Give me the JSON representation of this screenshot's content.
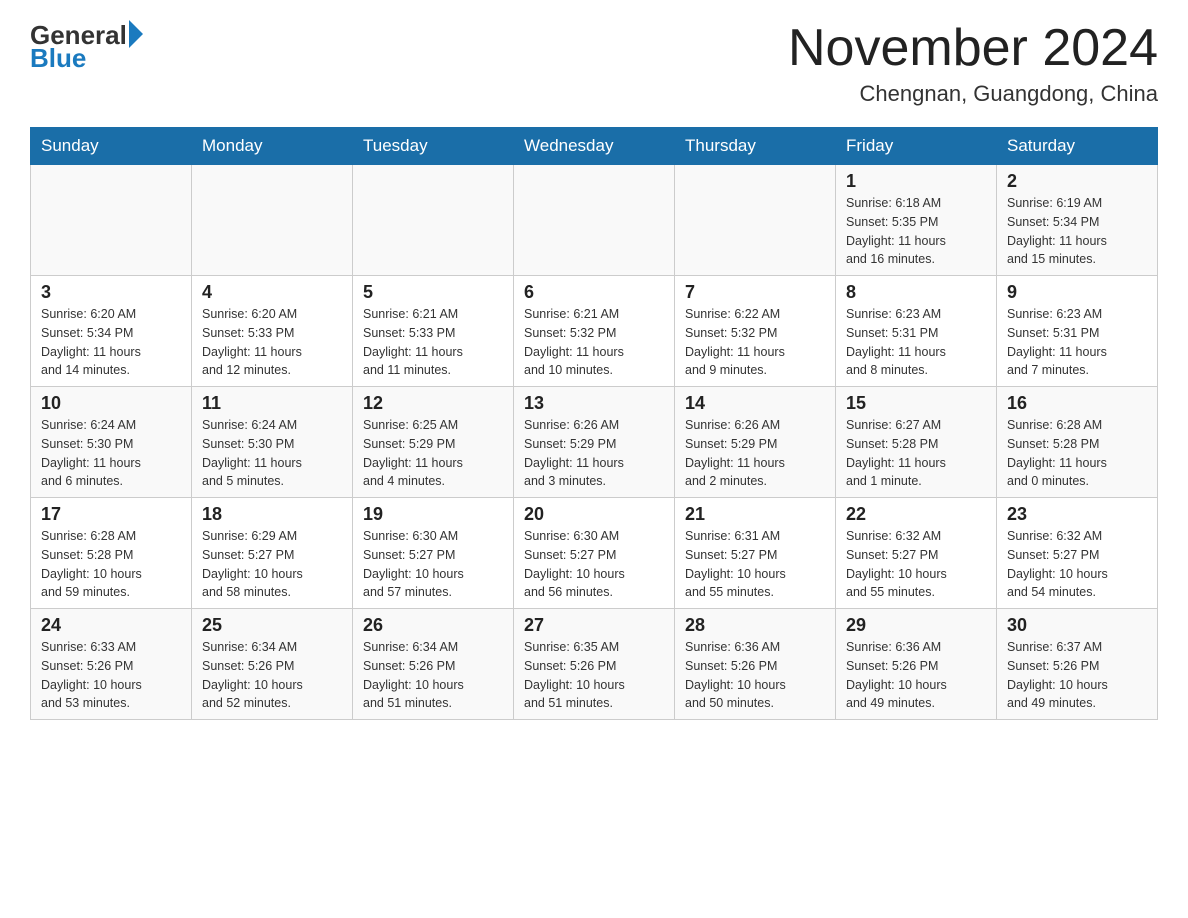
{
  "header": {
    "logo_general": "General",
    "logo_blue": "Blue",
    "month_title": "November 2024",
    "location": "Chengnan, Guangdong, China"
  },
  "weekdays": [
    "Sunday",
    "Monday",
    "Tuesday",
    "Wednesday",
    "Thursday",
    "Friday",
    "Saturday"
  ],
  "weeks": [
    [
      {
        "day": "",
        "info": ""
      },
      {
        "day": "",
        "info": ""
      },
      {
        "day": "",
        "info": ""
      },
      {
        "day": "",
        "info": ""
      },
      {
        "day": "",
        "info": ""
      },
      {
        "day": "1",
        "info": "Sunrise: 6:18 AM\nSunset: 5:35 PM\nDaylight: 11 hours\nand 16 minutes."
      },
      {
        "day": "2",
        "info": "Sunrise: 6:19 AM\nSunset: 5:34 PM\nDaylight: 11 hours\nand 15 minutes."
      }
    ],
    [
      {
        "day": "3",
        "info": "Sunrise: 6:20 AM\nSunset: 5:34 PM\nDaylight: 11 hours\nand 14 minutes."
      },
      {
        "day": "4",
        "info": "Sunrise: 6:20 AM\nSunset: 5:33 PM\nDaylight: 11 hours\nand 12 minutes."
      },
      {
        "day": "5",
        "info": "Sunrise: 6:21 AM\nSunset: 5:33 PM\nDaylight: 11 hours\nand 11 minutes."
      },
      {
        "day": "6",
        "info": "Sunrise: 6:21 AM\nSunset: 5:32 PM\nDaylight: 11 hours\nand 10 minutes."
      },
      {
        "day": "7",
        "info": "Sunrise: 6:22 AM\nSunset: 5:32 PM\nDaylight: 11 hours\nand 9 minutes."
      },
      {
        "day": "8",
        "info": "Sunrise: 6:23 AM\nSunset: 5:31 PM\nDaylight: 11 hours\nand 8 minutes."
      },
      {
        "day": "9",
        "info": "Sunrise: 6:23 AM\nSunset: 5:31 PM\nDaylight: 11 hours\nand 7 minutes."
      }
    ],
    [
      {
        "day": "10",
        "info": "Sunrise: 6:24 AM\nSunset: 5:30 PM\nDaylight: 11 hours\nand 6 minutes."
      },
      {
        "day": "11",
        "info": "Sunrise: 6:24 AM\nSunset: 5:30 PM\nDaylight: 11 hours\nand 5 minutes."
      },
      {
        "day": "12",
        "info": "Sunrise: 6:25 AM\nSunset: 5:29 PM\nDaylight: 11 hours\nand 4 minutes."
      },
      {
        "day": "13",
        "info": "Sunrise: 6:26 AM\nSunset: 5:29 PM\nDaylight: 11 hours\nand 3 minutes."
      },
      {
        "day": "14",
        "info": "Sunrise: 6:26 AM\nSunset: 5:29 PM\nDaylight: 11 hours\nand 2 minutes."
      },
      {
        "day": "15",
        "info": "Sunrise: 6:27 AM\nSunset: 5:28 PM\nDaylight: 11 hours\nand 1 minute."
      },
      {
        "day": "16",
        "info": "Sunrise: 6:28 AM\nSunset: 5:28 PM\nDaylight: 11 hours\nand 0 minutes."
      }
    ],
    [
      {
        "day": "17",
        "info": "Sunrise: 6:28 AM\nSunset: 5:28 PM\nDaylight: 10 hours\nand 59 minutes."
      },
      {
        "day": "18",
        "info": "Sunrise: 6:29 AM\nSunset: 5:27 PM\nDaylight: 10 hours\nand 58 minutes."
      },
      {
        "day": "19",
        "info": "Sunrise: 6:30 AM\nSunset: 5:27 PM\nDaylight: 10 hours\nand 57 minutes."
      },
      {
        "day": "20",
        "info": "Sunrise: 6:30 AM\nSunset: 5:27 PM\nDaylight: 10 hours\nand 56 minutes."
      },
      {
        "day": "21",
        "info": "Sunrise: 6:31 AM\nSunset: 5:27 PM\nDaylight: 10 hours\nand 55 minutes."
      },
      {
        "day": "22",
        "info": "Sunrise: 6:32 AM\nSunset: 5:27 PM\nDaylight: 10 hours\nand 55 minutes."
      },
      {
        "day": "23",
        "info": "Sunrise: 6:32 AM\nSunset: 5:27 PM\nDaylight: 10 hours\nand 54 minutes."
      }
    ],
    [
      {
        "day": "24",
        "info": "Sunrise: 6:33 AM\nSunset: 5:26 PM\nDaylight: 10 hours\nand 53 minutes."
      },
      {
        "day": "25",
        "info": "Sunrise: 6:34 AM\nSunset: 5:26 PM\nDaylight: 10 hours\nand 52 minutes."
      },
      {
        "day": "26",
        "info": "Sunrise: 6:34 AM\nSunset: 5:26 PM\nDaylight: 10 hours\nand 51 minutes."
      },
      {
        "day": "27",
        "info": "Sunrise: 6:35 AM\nSunset: 5:26 PM\nDaylight: 10 hours\nand 51 minutes."
      },
      {
        "day": "28",
        "info": "Sunrise: 6:36 AM\nSunset: 5:26 PM\nDaylight: 10 hours\nand 50 minutes."
      },
      {
        "day": "29",
        "info": "Sunrise: 6:36 AM\nSunset: 5:26 PM\nDaylight: 10 hours\nand 49 minutes."
      },
      {
        "day": "30",
        "info": "Sunrise: 6:37 AM\nSunset: 5:26 PM\nDaylight: 10 hours\nand 49 minutes."
      }
    ]
  ]
}
